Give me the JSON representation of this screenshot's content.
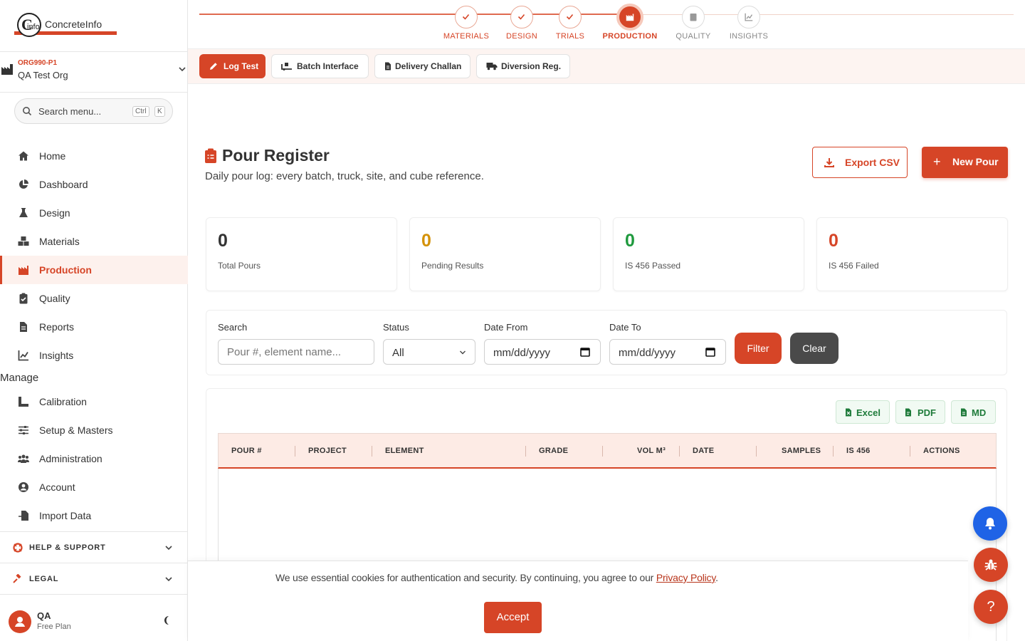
{
  "brand": {
    "logo_text": "ConcreteInfo",
    "logo_letter_c": "C",
    "logo_letter_i": "info",
    "accent_color": "#d64527"
  },
  "org": {
    "code": "ORG990-P1",
    "name": "QA Test Org"
  },
  "search": {
    "placeholder": "Search menu...",
    "kbd_ctrl": "Ctrl",
    "kbd_k": "K"
  },
  "nav": {
    "items": [
      {
        "label": "Home",
        "icon": "home-icon"
      },
      {
        "label": "Dashboard",
        "icon": "pie-chart-icon"
      },
      {
        "label": "Design",
        "icon": "flask-icon"
      },
      {
        "label": "Materials",
        "icon": "cubes-icon"
      },
      {
        "label": "Production",
        "icon": "industry-icon",
        "active": true
      },
      {
        "label": "Quality",
        "icon": "clipboard-check-icon"
      },
      {
        "label": "Reports",
        "icon": "file-icon"
      },
      {
        "label": "Insights",
        "icon": "line-chart-icon"
      }
    ],
    "manage_label": "Manage",
    "manage_items": [
      {
        "label": "Calibration",
        "icon": "ruler-icon"
      },
      {
        "label": "Setup & Masters",
        "icon": "sliders-icon"
      },
      {
        "label": "Administration",
        "icon": "users-icon"
      },
      {
        "label": "Account",
        "icon": "user-circle-icon"
      },
      {
        "label": "Import Data",
        "icon": "file-import-icon"
      }
    ],
    "help_label": "HELP & SUPPORT",
    "legal_label": "LEGAL"
  },
  "user": {
    "name": "QA",
    "plan": "Free Plan"
  },
  "stepper": {
    "steps": [
      {
        "label": "MATERIALS",
        "state": "done"
      },
      {
        "label": "DESIGN",
        "state": "done"
      },
      {
        "label": "TRIALS",
        "state": "done"
      },
      {
        "label": "PRODUCTION",
        "state": "current"
      },
      {
        "label": "QUALITY",
        "state": "future"
      },
      {
        "label": "INSIGHTS",
        "state": "future"
      }
    ]
  },
  "quickbar": {
    "log_test": "Log Test",
    "batch_interface": "Batch Interface",
    "delivery_challan": "Delivery Challan",
    "diversion_reg": "Diversion Reg."
  },
  "page": {
    "title": "Pour Register",
    "subtitle": "Daily pour log: every batch, truck, site, and cube reference.",
    "export_csv": "Export CSV",
    "new_pour": "New Pour",
    "new_pour_plus": "+"
  },
  "stats": [
    {
      "value": "0",
      "label": "Total Pours",
      "color": "#333333"
    },
    {
      "value": "0",
      "label": "Pending Results",
      "color": "#d4920a"
    },
    {
      "value": "0",
      "label": "IS 456 Passed",
      "color": "#1f9a3e"
    },
    {
      "value": "0",
      "label": "IS 456 Failed",
      "color": "#d64527"
    }
  ],
  "filters": {
    "search_label": "Search",
    "search_placeholder": "Pour #, element name...",
    "status_label": "Status",
    "status_value": "All",
    "date_from_label": "Date From",
    "date_from_placeholder": "mm/dd/yyyy",
    "date_to_label": "Date To",
    "date_to_placeholder": "mm/dd/yyyy",
    "filter_button": "Filter",
    "clear_button": "Clear"
  },
  "table": {
    "export_excel": "Excel",
    "export_pdf": "PDF",
    "export_md": "MD",
    "columns": [
      "POUR #",
      "PROJECT",
      "ELEMENT",
      "GRADE",
      "VOL M³",
      "DATE",
      "SAMPLES",
      "IS 456",
      "ACTIONS"
    ],
    "rows": []
  },
  "cookie": {
    "text": "We use essential cookies for authentication and security. By continuing, you agree to our ",
    "link": "Privacy Policy",
    "suffix": ".",
    "accept": "Accept"
  },
  "fab": {
    "help_symbol": "?"
  }
}
